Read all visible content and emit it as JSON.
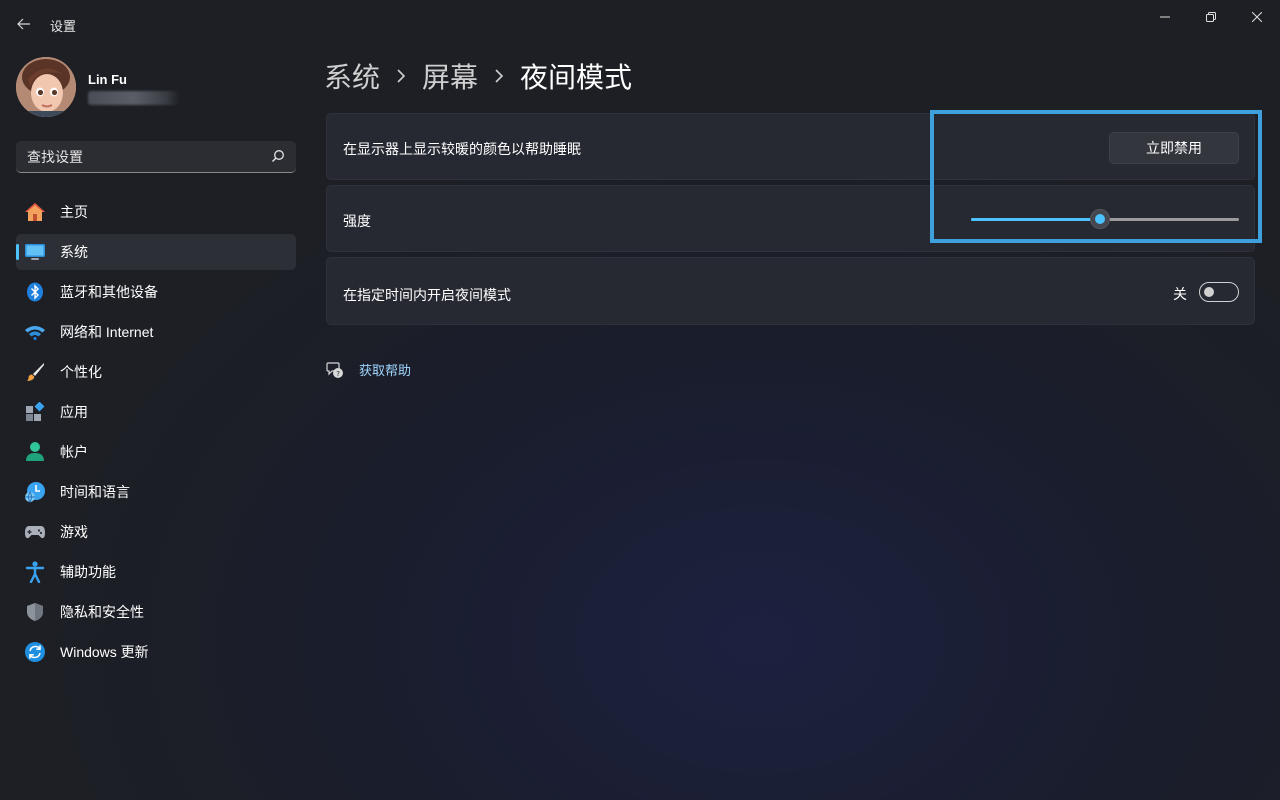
{
  "window": {
    "title": "设置",
    "back_icon": "back-arrow-icon",
    "controls": [
      "minimize-icon",
      "restore-icon",
      "close-icon"
    ]
  },
  "profile": {
    "name": "Lin Fu",
    "email_redacted": true
  },
  "search": {
    "placeholder": "查找设置",
    "value": ""
  },
  "sidebar": {
    "items": [
      {
        "label": "主页",
        "icon": "home-icon",
        "active": false
      },
      {
        "label": "系统",
        "icon": "system-monitor-icon",
        "active": true
      },
      {
        "label": "蓝牙和其他设备",
        "icon": "bluetooth-icon",
        "active": false
      },
      {
        "label": "网络和 Internet",
        "icon": "wifi-icon",
        "active": false
      },
      {
        "label": "个性化",
        "icon": "paintbrush-icon",
        "active": false
      },
      {
        "label": "应用",
        "icon": "apps-icon",
        "active": false
      },
      {
        "label": "帐户",
        "icon": "account-icon",
        "active": false
      },
      {
        "label": "时间和语言",
        "icon": "time-language-icon",
        "active": false
      },
      {
        "label": "游戏",
        "icon": "gamepad-icon",
        "active": false
      },
      {
        "label": "辅助功能",
        "icon": "accessibility-icon",
        "active": false
      },
      {
        "label": "隐私和安全性",
        "icon": "shield-icon",
        "active": false
      },
      {
        "label": "Windows 更新",
        "icon": "windows-update-icon",
        "active": false
      }
    ]
  },
  "breadcrumb": {
    "items": [
      "系统",
      "屏幕"
    ],
    "current": "夜间模式"
  },
  "main": {
    "night_light_row": {
      "label": "在显示器上显示较暖的颜色以帮助睡眠",
      "button_label": "立即禁用"
    },
    "strength_row": {
      "label": "强度",
      "value_fraction": 0.48
    },
    "schedule_row": {
      "label": "在指定时间内开启夜间模式",
      "toggle_state_label": "关",
      "toggle_on": false
    },
    "help": {
      "label": "获取帮助",
      "icon": "help-chat-icon"
    }
  },
  "colors": {
    "accent": "#4cc2ff",
    "highlight_border": "#3ea0dc",
    "card_bg": "#262932",
    "sidebar_bg": "#1d1f25"
  }
}
